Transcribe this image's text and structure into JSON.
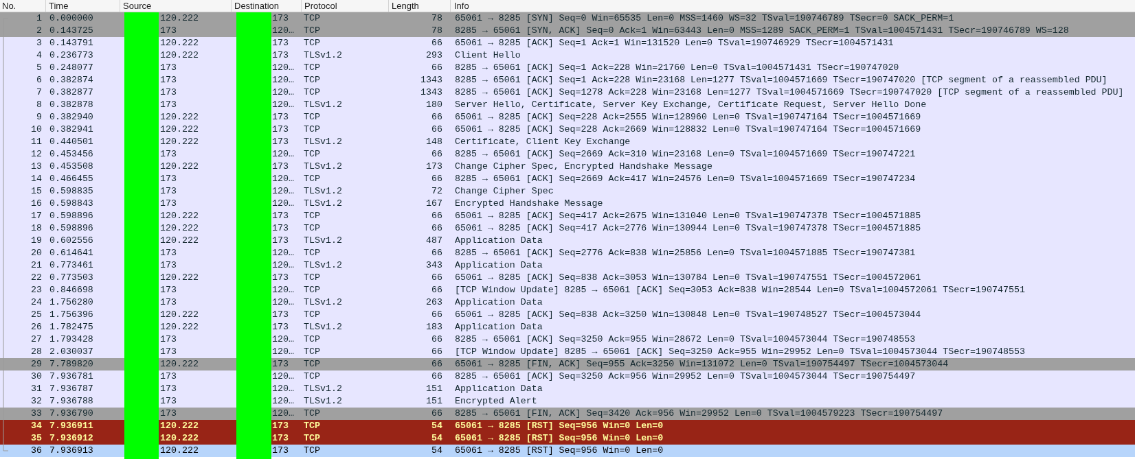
{
  "columns": [
    "No.",
    "Time",
    "Source",
    "Destination",
    "Protocol",
    "Length",
    "Info"
  ],
  "packets": [
    {
      "no": "1",
      "time": "0.000000",
      "source": "120.222",
      "destination": "173",
      "protocol": "TCP",
      "length": "78",
      "info": "65061 → 8285 [SYN] Seq=0 Win=65535 Len=0 MSS=1460 WS=32 TSval=190746789 TSecr=0 SACK_PERM=1",
      "color": "#a0a0a0",
      "selected": false
    },
    {
      "no": "2",
      "time": "0.143725",
      "source": "173",
      "destination": "120…",
      "protocol": "TCP",
      "length": "78",
      "info": "8285 → 65061 [SYN, ACK] Seq=0 Ack=1 Win=63443 Len=0 MSS=1289 SACK_PERM=1 TSval=1004571431 TSecr=190746789 WS=128",
      "color": "#a0a0a0",
      "selected": false
    },
    {
      "no": "3",
      "time": "0.143791",
      "source": "120.222",
      "destination": "173",
      "protocol": "TCP",
      "length": "66",
      "info": "65061 → 8285 [ACK] Seq=1 Ack=1 Win=131520 Len=0 TSval=190746929 TSecr=1004571431",
      "color": "#e7e6ff",
      "selected": false
    },
    {
      "no": "4",
      "time": "0.236773",
      "source": "120.222",
      "destination": "173",
      "protocol": "TLSv1.2",
      "length": "293",
      "info": "Client Hello",
      "color": "#e7e6ff",
      "selected": false
    },
    {
      "no": "5",
      "time": "0.248077",
      "source": "173",
      "destination": "120…",
      "protocol": "TCP",
      "length": "66",
      "info": "8285 → 65061 [ACK] Seq=1 Ack=228 Win=21760 Len=0 TSval=1004571431 TSecr=190747020",
      "color": "#e7e6ff",
      "selected": false
    },
    {
      "no": "6",
      "time": "0.382874",
      "source": "173",
      "destination": "120…",
      "protocol": "TCP",
      "length": "1343",
      "info": "8285 → 65061 [ACK] Seq=1 Ack=228 Win=23168 Len=1277 TSval=1004571669 TSecr=190747020 [TCP segment of a reassembled PDU]",
      "color": "#e7e6ff",
      "selected": false
    },
    {
      "no": "7",
      "time": "0.382877",
      "source": "173",
      "destination": "120…",
      "protocol": "TCP",
      "length": "1343",
      "info": "8285 → 65061 [ACK] Seq=1278 Ack=228 Win=23168 Len=1277 TSval=1004571669 TSecr=190747020 [TCP segment of a reassembled PDU]",
      "color": "#e7e6ff",
      "selected": false
    },
    {
      "no": "8",
      "time": "0.382878",
      "source": "173",
      "destination": "120…",
      "protocol": "TLSv1.2",
      "length": "180",
      "info": "Server Hello, Certificate, Server Key Exchange, Certificate Request, Server Hello Done",
      "color": "#e7e6ff",
      "selected": false
    },
    {
      "no": "9",
      "time": "0.382940",
      "source": "120.222",
      "destination": "173",
      "protocol": "TCP",
      "length": "66",
      "info": "65061 → 8285 [ACK] Seq=228 Ack=2555 Win=128960 Len=0 TSval=190747164 TSecr=1004571669",
      "color": "#e7e6ff",
      "selected": false
    },
    {
      "no": "10",
      "time": "0.382941",
      "source": "120.222",
      "destination": "173",
      "protocol": "TCP",
      "length": "66",
      "info": "65061 → 8285 [ACK] Seq=228 Ack=2669 Win=128832 Len=0 TSval=190747164 TSecr=1004571669",
      "color": "#e7e6ff",
      "selected": false
    },
    {
      "no": "11",
      "time": "0.440501",
      "source": "120.222",
      "destination": "173",
      "protocol": "TLSv1.2",
      "length": "148",
      "info": "Certificate, Client Key Exchange",
      "color": "#e7e6ff",
      "selected": false
    },
    {
      "no": "12",
      "time": "0.453456",
      "source": "173",
      "destination": "120…",
      "protocol": "TCP",
      "length": "66",
      "info": "8285 → 65061 [ACK] Seq=2669 Ack=310 Win=23168 Len=0 TSval=1004571669 TSecr=190747221",
      "color": "#e7e6ff",
      "selected": false
    },
    {
      "no": "13",
      "time": "0.453508",
      "source": "120.222",
      "destination": "173",
      "protocol": "TLSv1.2",
      "length": "173",
      "info": "Change Cipher Spec, Encrypted Handshake Message",
      "color": "#e7e6ff",
      "selected": false
    },
    {
      "no": "14",
      "time": "0.466455",
      "source": "173",
      "destination": "120…",
      "protocol": "TCP",
      "length": "66",
      "info": "8285 → 65061 [ACK] Seq=2669 Ack=417 Win=24576 Len=0 TSval=1004571669 TSecr=190747234",
      "color": "#e7e6ff",
      "selected": false
    },
    {
      "no": "15",
      "time": "0.598835",
      "source": "173",
      "destination": "120…",
      "protocol": "TLSv1.2",
      "length": "72",
      "info": "Change Cipher Spec",
      "color": "#e7e6ff",
      "selected": false
    },
    {
      "no": "16",
      "time": "0.598843",
      "source": "173",
      "destination": "120…",
      "protocol": "TLSv1.2",
      "length": "167",
      "info": "Encrypted Handshake Message",
      "color": "#e7e6ff",
      "selected": false
    },
    {
      "no": "17",
      "time": "0.598896",
      "source": "120.222",
      "destination": "173",
      "protocol": "TCP",
      "length": "66",
      "info": "65061 → 8285 [ACK] Seq=417 Ack=2675 Win=131040 Len=0 TSval=190747378 TSecr=1004571885",
      "color": "#e7e6ff",
      "selected": false
    },
    {
      "no": "18",
      "time": "0.598896",
      "source": "120.222",
      "destination": "173",
      "protocol": "TCP",
      "length": "66",
      "info": "65061 → 8285 [ACK] Seq=417 Ack=2776 Win=130944 Len=0 TSval=190747378 TSecr=1004571885",
      "color": "#e7e6ff",
      "selected": false
    },
    {
      "no": "19",
      "time": "0.602556",
      "source": "120.222",
      "destination": "173",
      "protocol": "TLSv1.2",
      "length": "487",
      "info": "Application Data",
      "color": "#e7e6ff",
      "selected": false
    },
    {
      "no": "20",
      "time": "0.614641",
      "source": "173",
      "destination": "120…",
      "protocol": "TCP",
      "length": "66",
      "info": "8285 → 65061 [ACK] Seq=2776 Ack=838 Win=25856 Len=0 TSval=1004571885 TSecr=190747381",
      "color": "#e7e6ff",
      "selected": false
    },
    {
      "no": "21",
      "time": "0.773461",
      "source": "173",
      "destination": "120…",
      "protocol": "TLSv1.2",
      "length": "343",
      "info": "Application Data",
      "color": "#e7e6ff",
      "selected": false
    },
    {
      "no": "22",
      "time": "0.773503",
      "source": "120.222",
      "destination": "173",
      "protocol": "TCP",
      "length": "66",
      "info": "65061 → 8285 [ACK] Seq=838 Ack=3053 Win=130784 Len=0 TSval=190747551 TSecr=1004572061",
      "color": "#e7e6ff",
      "selected": false
    },
    {
      "no": "23",
      "time": "0.846698",
      "source": "173",
      "destination": "120…",
      "protocol": "TCP",
      "length": "66",
      "info": "[TCP Window Update] 8285 → 65061 [ACK] Seq=3053 Ack=838 Win=28544 Len=0 TSval=1004572061 TSecr=190747551",
      "color": "#e7e6ff",
      "selected": false
    },
    {
      "no": "24",
      "time": "1.756280",
      "source": "173",
      "destination": "120…",
      "protocol": "TLSv1.2",
      "length": "263",
      "info": "Application Data",
      "color": "#e7e6ff",
      "selected": false
    },
    {
      "no": "25",
      "time": "1.756396",
      "source": "120.222",
      "destination": "173",
      "protocol": "TCP",
      "length": "66",
      "info": "65061 → 8285 [ACK] Seq=838 Ack=3250 Win=130848 Len=0 TSval=190748527 TSecr=1004573044",
      "color": "#e7e6ff",
      "selected": false
    },
    {
      "no": "26",
      "time": "1.782475",
      "source": "120.222",
      "destination": "173",
      "protocol": "TLSv1.2",
      "length": "183",
      "info": "Application Data",
      "color": "#e7e6ff",
      "selected": false
    },
    {
      "no": "27",
      "time": "1.793428",
      "source": "173",
      "destination": "120…",
      "protocol": "TCP",
      "length": "66",
      "info": "8285 → 65061 [ACK] Seq=3250 Ack=955 Win=28672 Len=0 TSval=1004573044 TSecr=190748553",
      "color": "#e7e6ff",
      "selected": false
    },
    {
      "no": "28",
      "time": "2.030037",
      "source": "173",
      "destination": "120…",
      "protocol": "TCP",
      "length": "66",
      "info": "[TCP Window Update] 8285 → 65061 [ACK] Seq=3250 Ack=955 Win=29952 Len=0 TSval=1004573044 TSecr=190748553",
      "color": "#e7e6ff",
      "selected": false
    },
    {
      "no": "29",
      "time": "7.789820",
      "source": "120.222",
      "destination": "173",
      "protocol": "TCP",
      "length": "66",
      "info": "65061 → 8285 [FIN, ACK] Seq=955 Ack=3250 Win=131072 Len=0 TSval=190754497 TSecr=1004573044",
      "color": "#a0a0a0",
      "selected": false
    },
    {
      "no": "30",
      "time": "7.936781",
      "source": "173",
      "destination": "120…",
      "protocol": "TCP",
      "length": "66",
      "info": "8285 → 65061 [ACK] Seq=3250 Ack=956 Win=29952 Len=0 TSval=1004573044 TSecr=190754497",
      "color": "#e7e6ff",
      "selected": false
    },
    {
      "no": "31",
      "time": "7.936787",
      "source": "173",
      "destination": "120…",
      "protocol": "TLSv1.2",
      "length": "151",
      "info": "Application Data",
      "color": "#e7e6ff",
      "selected": false
    },
    {
      "no": "32",
      "time": "7.936788",
      "source": "173",
      "destination": "120…",
      "protocol": "TLSv1.2",
      "length": "151",
      "info": "Encrypted Alert",
      "color": "#e7e6ff",
      "selected": false
    },
    {
      "no": "33",
      "time": "7.936790",
      "source": "173",
      "destination": "120…",
      "protocol": "TCP",
      "length": "66",
      "info": "8285 → 65061 [FIN, ACK] Seq=3420 Ack=956 Win=29952 Len=0 TSval=1004579223 TSecr=190754497",
      "color": "#a0a0a0",
      "selected": false
    },
    {
      "no": "34",
      "time": "7.936911",
      "source": "120.222",
      "destination": "173",
      "protocol": "TCP",
      "length": "54",
      "info": "65061 → 8285 [RST] Seq=956 Win=0 Len=0",
      "color": "#982416",
      "selected": false
    },
    {
      "no": "35",
      "time": "7.936912",
      "source": "120.222",
      "destination": "173",
      "protocol": "TCP",
      "length": "54",
      "info": "65061 → 8285 [RST] Seq=956 Win=0 Len=0",
      "color": "#982416",
      "selected": false
    },
    {
      "no": "36",
      "time": "7.936913",
      "source": "120.222",
      "destination": "173",
      "protocol": "TCP",
      "length": "54",
      "info": "65061 → 8285 [RST] Seq=956 Win=0 Len=0",
      "selected": true
    }
  ]
}
